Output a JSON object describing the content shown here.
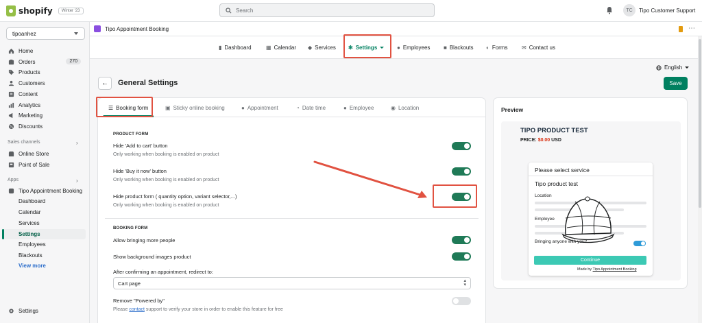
{
  "topbar": {
    "logo_text": "shopify",
    "badge": "Winter '23",
    "search_placeholder": "Search",
    "avatar_initials": "TC",
    "store_label": "Tipo Customer Support"
  },
  "sidebar": {
    "store": "tipoanhez",
    "items": [
      {
        "label": "Home",
        "icon": "home-icon"
      },
      {
        "label": "Orders",
        "icon": "orders-icon",
        "count": "270"
      },
      {
        "label": "Products",
        "icon": "tag-icon"
      },
      {
        "label": "Customers",
        "icon": "person-icon"
      },
      {
        "label": "Content",
        "icon": "content-icon"
      },
      {
        "label": "Analytics",
        "icon": "analytics-icon"
      },
      {
        "label": "Marketing",
        "icon": "marketing-icon"
      },
      {
        "label": "Discounts",
        "icon": "discount-icon"
      }
    ],
    "sales_channels_heading": "Sales channels",
    "sales_channels": [
      {
        "label": "Online Store",
        "icon": "store-icon"
      },
      {
        "label": "Point of Sale",
        "icon": "pos-icon"
      }
    ],
    "apps_heading": "Apps",
    "app_name": "Tipo Appointment Booking",
    "app_sub_items": [
      "Dashboard",
      "Calendar",
      "Services",
      "Settings",
      "Employees",
      "Blackouts"
    ],
    "view_more": "View more",
    "settings_label": "Settings"
  },
  "app_header": {
    "title": "Tipo Appointment Booking"
  },
  "topnav": {
    "items": [
      {
        "label": "Dashboard",
        "icon": "chart-icon"
      },
      {
        "label": "Calendar",
        "icon": "calendar-icon"
      },
      {
        "label": "Services",
        "icon": "tag-icon"
      },
      {
        "label": "Settings",
        "icon": "gear-icon"
      },
      {
        "label": "Employees",
        "icon": "person-icon"
      },
      {
        "label": "Blackouts",
        "icon": "lock-icon"
      },
      {
        "label": "Forms",
        "icon": "toggle-icon"
      },
      {
        "label": "Contact us",
        "icon": "mail-icon"
      }
    ]
  },
  "language": "English",
  "page": {
    "title": "General Settings",
    "save_label": "Save"
  },
  "tabs": [
    {
      "label": "Booking form",
      "icon": "sliders-icon"
    },
    {
      "label": "Sticky online booking",
      "icon": "sticky-icon"
    },
    {
      "label": "Appointment",
      "icon": "clock-icon"
    },
    {
      "label": "Date time",
      "icon": "clock-icon"
    },
    {
      "label": "Employee",
      "icon": "person-icon"
    },
    {
      "label": "Location",
      "icon": "pin-icon"
    }
  ],
  "product_form": {
    "heading": "PRODUCT FORM",
    "options": [
      {
        "label": "Hide 'Add to cart' button",
        "help": "Only working when booking is enabled on product",
        "on": true
      },
      {
        "label": "Hide 'Buy it now' button",
        "help": "Only working when booking is enabled on product",
        "on": true
      },
      {
        "label": "Hide product form ( quantity option, variant selector,...)",
        "help": "Only working when booking is enabled on product",
        "on": true
      }
    ]
  },
  "booking_form": {
    "heading": "BOOKING FORM",
    "allow_more_people": "Allow bringing more people",
    "show_bg_images": "Show background images product",
    "redirect_label": "After confirming an appointment, redirect to:",
    "redirect_value": "Cart page",
    "remove_powered_by": "Remove \"Powered by\"",
    "please": "Please",
    "contact": "contact",
    "support_text": "support to verify your store in order to enable this feature for free"
  },
  "preview": {
    "title": "Preview",
    "product_title": "TIPO PRODUCT TEST",
    "price_label": "PRICE:",
    "price_value": "$0.00",
    "currency": "USD",
    "select_service": "Please select service",
    "product_name": "Tipo product test",
    "location_label": "Location",
    "employee_label": "Employee",
    "bringing_label": "Bringing anyone with you?",
    "continue_label": "Continue",
    "made_by": "Made by",
    "made_by_link": "Tipo Appointment Booking"
  },
  "colors": {
    "primary": "#008060",
    "toggle_on": "#1f7a57",
    "highlight": "#e15241",
    "continue": "#3cc9b4"
  }
}
